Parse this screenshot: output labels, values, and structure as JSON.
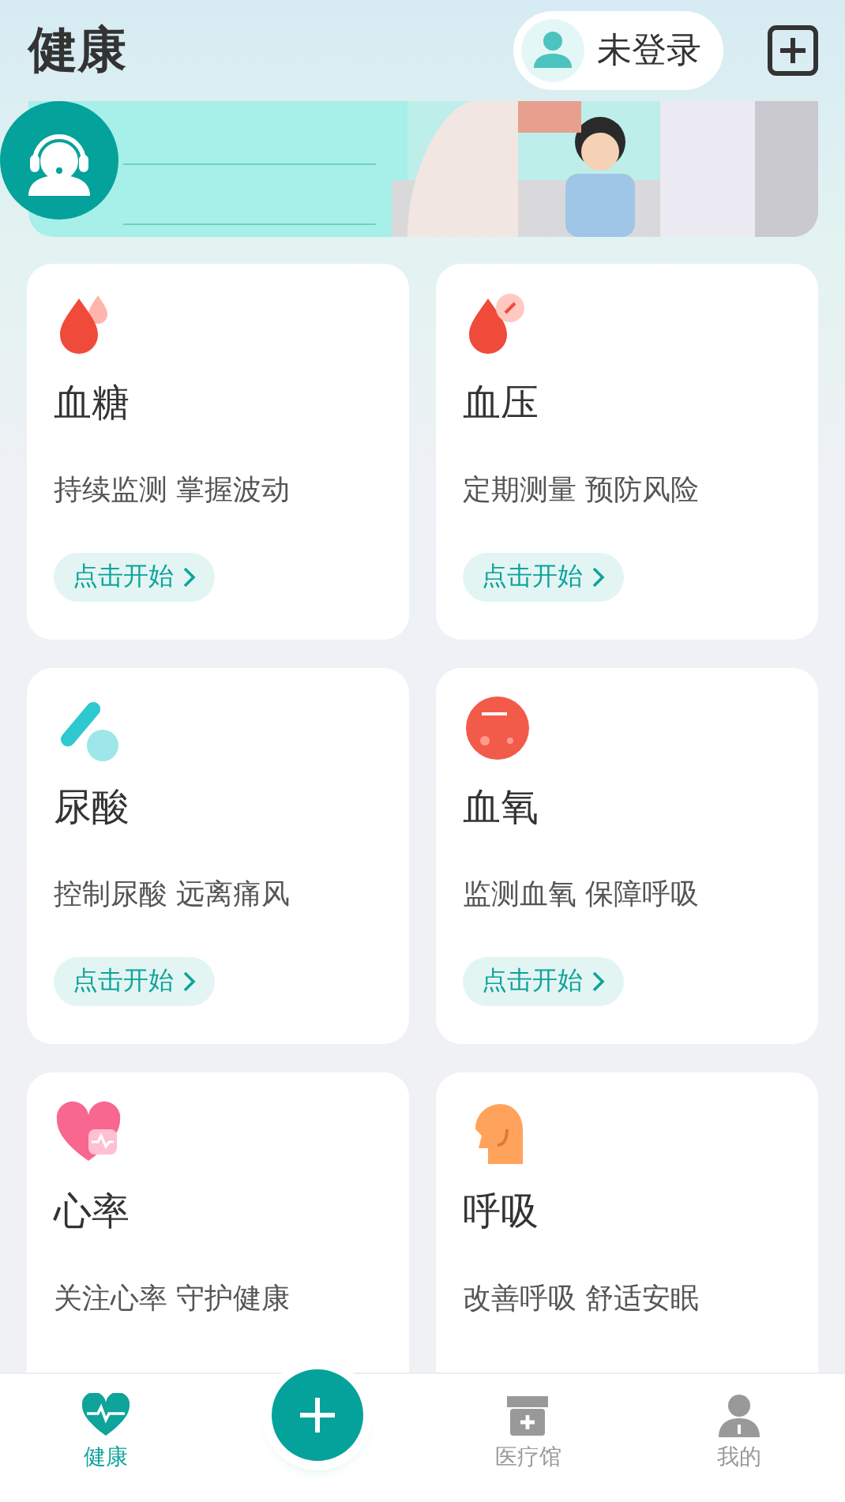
{
  "header": {
    "title": "健康",
    "login": "未登录"
  },
  "cards": [
    {
      "kind": "glucose",
      "title": "血糖",
      "desc": "持续监测 掌握波动",
      "button": "点击开始"
    },
    {
      "kind": "pressure",
      "title": "血压",
      "desc": "定期测量 预防风险",
      "button": "点击开始"
    },
    {
      "kind": "uric",
      "title": "尿酸",
      "desc": "控制尿酸 远离痛风",
      "button": "点击开始"
    },
    {
      "kind": "oxygen",
      "title": "血氧",
      "desc": "监测血氧 保障呼吸",
      "button": "点击开始"
    },
    {
      "kind": "heart",
      "title": "心率",
      "desc": "关注心率 守护健康"
    },
    {
      "kind": "breath",
      "title": "呼吸",
      "desc": "改善呼吸 舒适安眠"
    }
  ],
  "tabbar": [
    {
      "kind": "heart",
      "label": "健康",
      "selected": true
    },
    {
      "kind": "add"
    },
    {
      "kind": "store",
      "label": "医疗馆",
      "selected": false
    },
    {
      "kind": "person",
      "label": "我的",
      "selected": false
    }
  ]
}
